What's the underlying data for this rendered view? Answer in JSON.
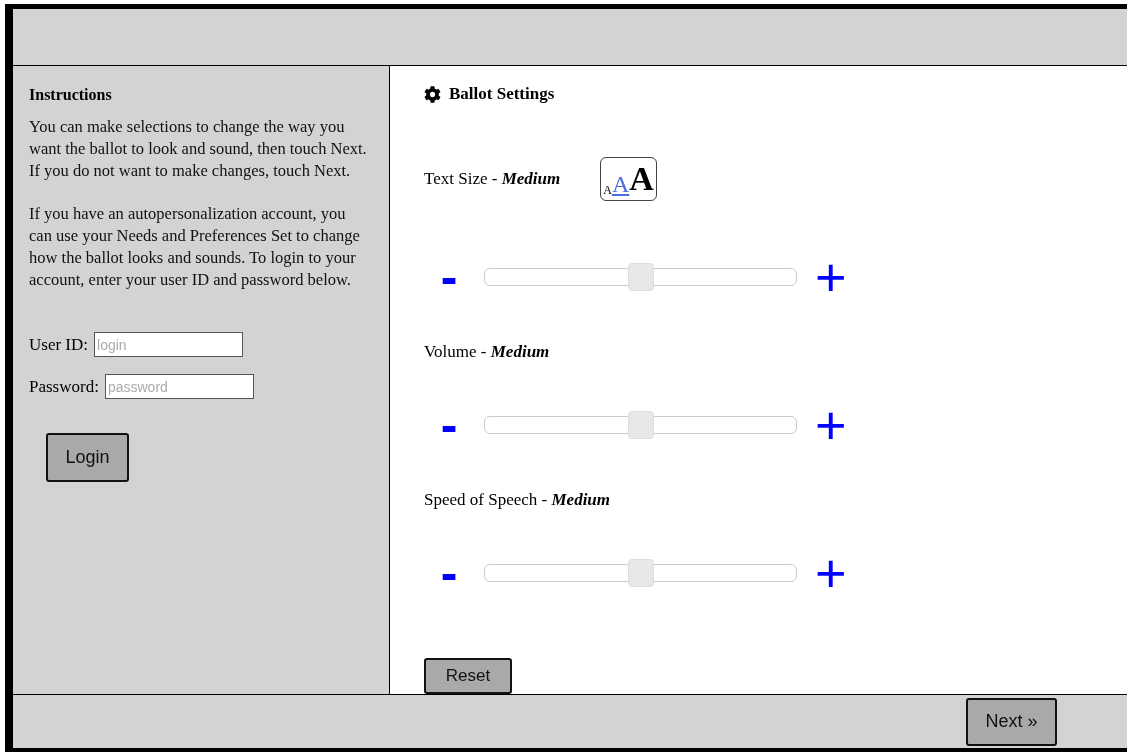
{
  "instructions": {
    "title": "Instructions",
    "paragraphs": [
      "You can make selections to change the way you want the ballot to look and sound, then touch Next. If you do not want to make changes, touch Next.",
      "If you have an autopersonalization account, you can use your Needs and Preferences Set to change how the ballot looks and sounds. To login to your account, enter your user ID and password below."
    ]
  },
  "login": {
    "fields": [
      {
        "label": "User ID:",
        "placeholder": "login"
      },
      {
        "label": "Password:",
        "placeholder": "password"
      }
    ],
    "button": "Login"
  },
  "settings": {
    "title": "Ballot Settings",
    "size_options": [
      {
        "label": "A",
        "selected": false
      },
      {
        "label": "A",
        "selected": true
      },
      {
        "label": "A",
        "selected": false
      }
    ],
    "sliders": [
      {
        "label": "Text Size - ",
        "value": "Medium",
        "level": 0.5,
        "decrease": "-",
        "increase": "+"
      },
      {
        "label": "Volume - ",
        "value": "Medium",
        "level": 0.5,
        "decrease": "-",
        "increase": "+"
      },
      {
        "label": "Speed of Speech - ",
        "value": "Medium",
        "level": 0.5,
        "decrease": "-",
        "increase": "+"
      }
    ],
    "reset": "Reset"
  },
  "footer": {
    "next": "Next »"
  }
}
